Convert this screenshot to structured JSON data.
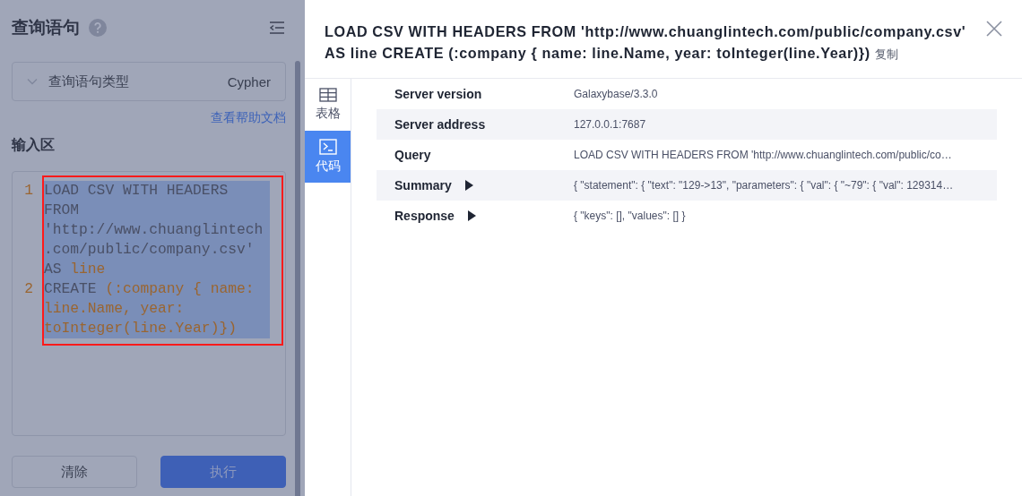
{
  "query_panel": {
    "title": "查询语句",
    "type_select": {
      "label": "查询语句类型",
      "value": "Cypher",
      "expanded": false
    },
    "help_link": "查看帮助文档",
    "input_heading": "输入区",
    "editor": {
      "selected": true,
      "highlighted": true,
      "lines": [
        {
          "number": "1",
          "tokens": [
            {
              "text": "LOAD CSV WITH HEADERS FROM 'http://www.chuanglintech.com/public/company.csv' AS ",
              "kind": "plain"
            },
            {
              "text": "line",
              "kind": "variable"
            }
          ]
        },
        {
          "number": "2",
          "tokens": [
            {
              "text": "CREATE ",
              "kind": "plain"
            },
            {
              "text": "(:company { name: line.Name, year: toInteger(line.Year)})",
              "kind": "variable"
            }
          ]
        }
      ]
    },
    "buttons": [
      {
        "label": "清除",
        "kind": "secondary"
      },
      {
        "label": "执行",
        "kind": "primary"
      }
    ]
  },
  "drawer": {
    "title": "LOAD CSV WITH HEADERS FROM 'http://www.chuanglintech.com/public/company.csv' AS line CREATE (:company { name: line.Name, year: toInteger(line.Year)})",
    "copy_label": "复制",
    "tabs": [
      {
        "label": "表格",
        "kind": "table",
        "selected": false
      },
      {
        "label": "代码",
        "kind": "code",
        "selected": true
      }
    ],
    "rows": [
      {
        "key": "Server version",
        "value": "Galaxybase/3.3.0",
        "kind": "text"
      },
      {
        "key": "Server address",
        "value": "127.0.0.1:7687",
        "kind": "text"
      },
      {
        "key": "Query",
        "value": "LOAD CSV WITH HEADERS FROM 'http://www.chuanglintech.com/public/co…",
        "kind": "text"
      },
      {
        "key": "Summary",
        "value": "{ \"statement\": { \"text\": \"129->13\", \"parameters\": { \"val\": { \"~79\": { \"val\": 129314…",
        "kind": "toggle",
        "expanded": false
      },
      {
        "key": "Response",
        "value": "{ \"keys\": [], \"values\": [] }",
        "kind": "toggle",
        "expanded": false
      }
    ]
  }
}
